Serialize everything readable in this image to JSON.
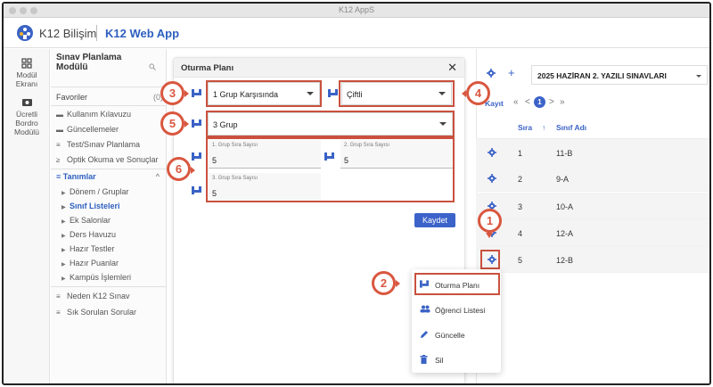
{
  "window": {
    "title": "K12 AppS"
  },
  "header": {
    "brand": "K12 Bilişim",
    "app_name": "K12 Web App"
  },
  "rail": {
    "items": [
      {
        "label1": "Modül",
        "label2": "Ekranı"
      },
      {
        "label1": "Ücretli",
        "label2": "Bordro",
        "label3": "Modülü"
      }
    ]
  },
  "nav": {
    "title": "Sınav Planlama Modülü",
    "favorites_label": "Favoriler",
    "favorites_count": "(0)",
    "items": [
      "Kullanım Kılavuzu",
      "Güncellemeler",
      "Test/Sınav Planlama",
      "Optik Okuma ve Sonuçlar"
    ],
    "group_label": "Tanımlar",
    "sub_items": [
      "Dönem / Gruplar",
      "Sınıf Listeleri",
      "Ek Salonlar",
      "Ders Havuzu",
      "Hazır Testler",
      "Hazır Puanlar",
      "Kampüs İşlemleri"
    ],
    "bottom_items": [
      "Neden K12 Sınav",
      "Sık Sorulan Sorular"
    ]
  },
  "dialog": {
    "title": "Oturma Planı",
    "close": "✕",
    "layout_select": "1 Grup Karşısında",
    "seating_select": "Çiftli",
    "group_select": "3 Grup",
    "field1_label": "1. Grup Sıra Sayısı",
    "field1_value": "5",
    "field2_label": "2. Grup Sıra Sayısı",
    "field2_value": "5",
    "field3_label": "3. Grup Sıra Sayısı",
    "field3_value": "5",
    "save": "Kaydet"
  },
  "badges": [
    "1",
    "2",
    "3",
    "4",
    "5",
    "6"
  ],
  "right_panel": {
    "exam": "2025 HAZİRAN 2. YAZILI SINAVLARI",
    "add": "+",
    "pager_label": "Kayıt",
    "first": "«",
    "prev": "<",
    "page": "1",
    "next": ">",
    "last": "»",
    "col_sira": "Sıra",
    "col_sinif": "Sınıf Adı",
    "rows": [
      {
        "sira": "1",
        "sinif": "11-B"
      },
      {
        "sira": "2",
        "sinif": "9-A"
      },
      {
        "sira": "3",
        "sinif": "10-A"
      },
      {
        "sira": "4",
        "sinif": "12-A"
      },
      {
        "sira": "5",
        "sinif": "12-B"
      }
    ]
  },
  "context_menu": {
    "items": [
      "Oturma Planı",
      "Öğrenci Listesi",
      "Güncelle",
      "Sil"
    ]
  },
  "colors": {
    "accent": "#2d5fbf",
    "callout": "#d9573f",
    "button": "#3c63c9"
  }
}
